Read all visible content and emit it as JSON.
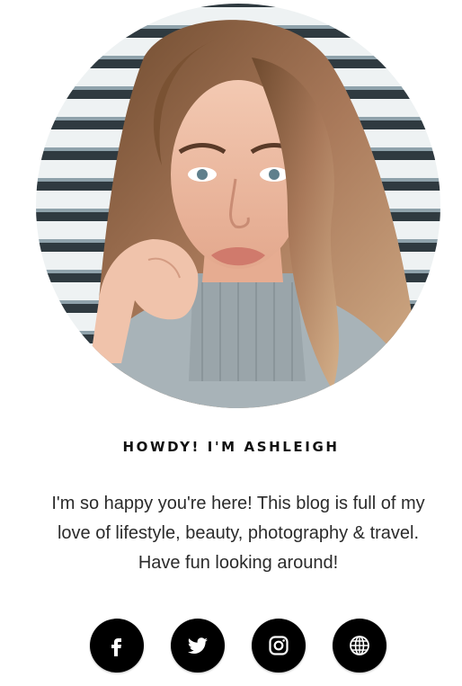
{
  "about": {
    "heading": "HOWDY! I'M ASHLEIGH",
    "bio_lines": [
      "I'm so happy you're here! This blog is full of my",
      "love of lifestyle, beauty, photography & travel.",
      "Have fun looking around!"
    ],
    "photo_icon": "profile-photo"
  },
  "social": [
    {
      "icon": "facebook-icon"
    },
    {
      "icon": "twitter-icon"
    },
    {
      "icon": "instagram-icon"
    },
    {
      "icon": "globe-icon"
    }
  ],
  "colors": {
    "heading": "#111111",
    "body_text": "#2b2b2b",
    "social_bg": "#000000",
    "social_fg": "#ffffff"
  }
}
